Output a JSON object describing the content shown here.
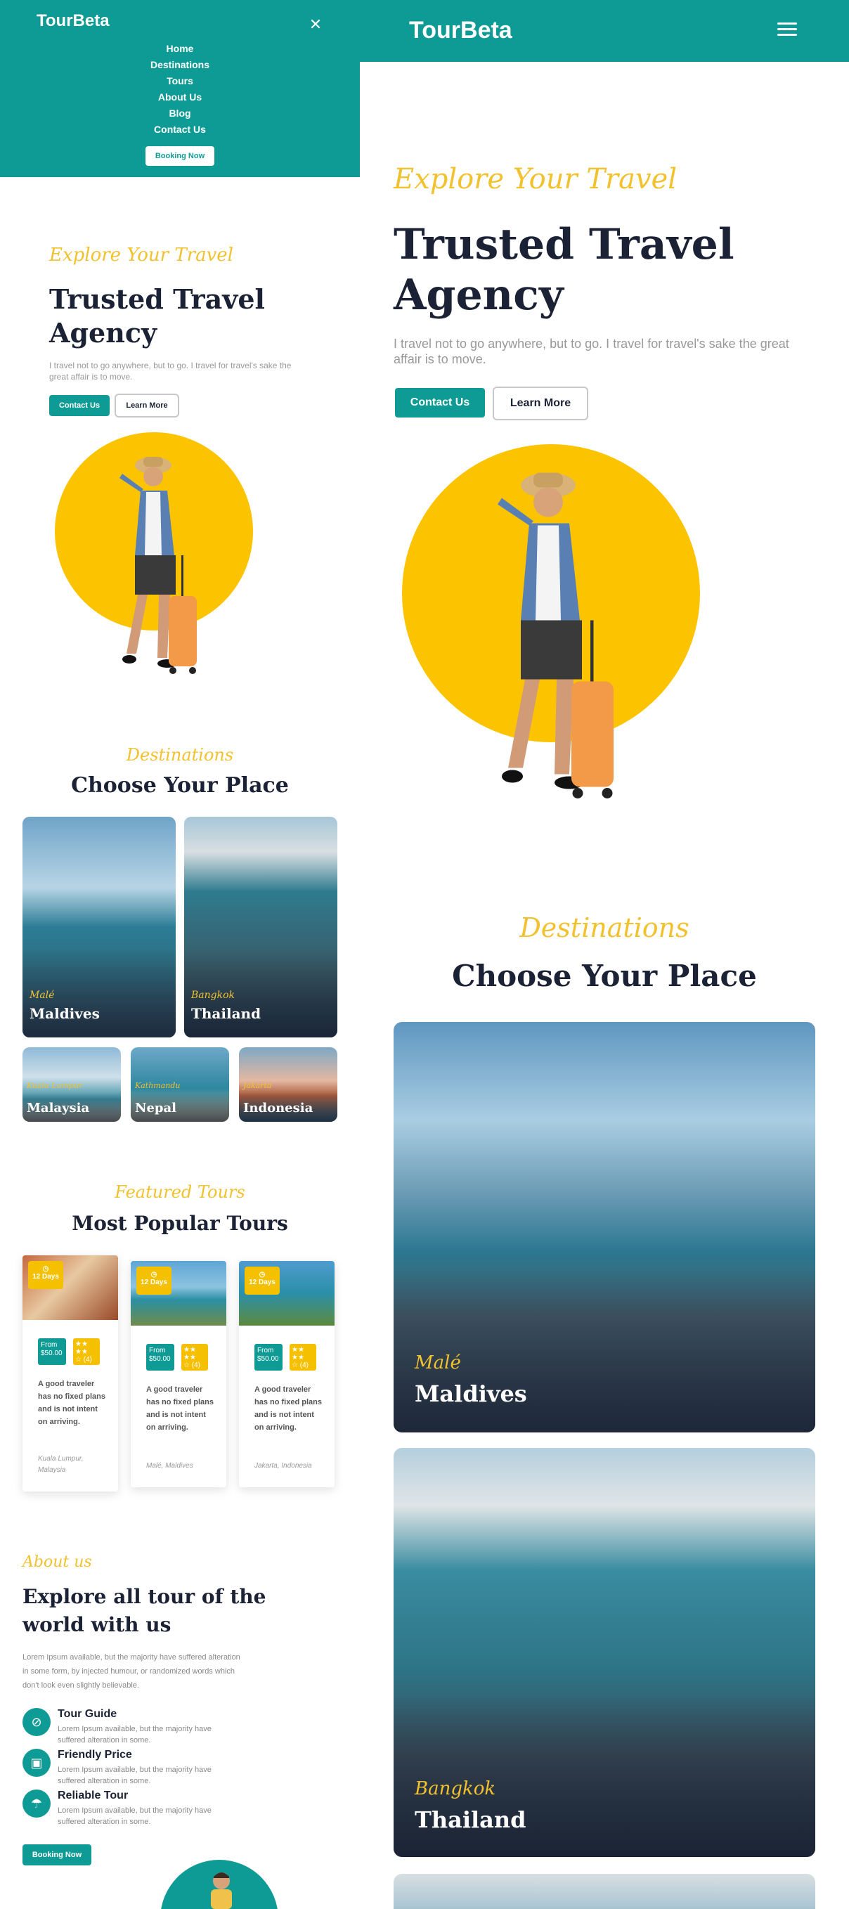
{
  "brand": "TourBeta",
  "menu": {
    "items": [
      "Home",
      "Destinations",
      "Tours",
      "About Us",
      "Blog",
      "Contact Us"
    ],
    "booking_label": "Booking Now"
  },
  "hero": {
    "script": "Explore Your Travel",
    "title_line1": "Trusted Travel",
    "title_line2": "Agency",
    "text": "I travel not to go anywhere, but to go. I travel for travel's sake the great affair is to move.",
    "contact_label": "Contact Us",
    "learn_label": "Learn More"
  },
  "destinations": {
    "script": "Destinations",
    "title": "Choose Your Place",
    "items": [
      {
        "city": "Malé",
        "country": "Maldives"
      },
      {
        "city": "Bangkok",
        "country": "Thailand"
      },
      {
        "city": "Kuala Lumpur",
        "country": "Malaysia"
      },
      {
        "city": "Kathmandu",
        "country": "Nepal"
      },
      {
        "city": "Jakarta",
        "country": "Indonesia"
      }
    ]
  },
  "tours": {
    "script": "Featured Tours",
    "title": "Most Popular Tours",
    "items": [
      {
        "days": "12 Days",
        "from": "From",
        "price": "$50.00",
        "rating_count": "(4)",
        "desc": "A good traveler has no fixed plans and is not intent on arriving.",
        "location": "Kuala Lumpur, Malaysia"
      },
      {
        "days": "12 Days",
        "from": "From",
        "price": "$50.00",
        "rating_count": "(4)",
        "desc": "A good traveler has no fixed plans and is not intent on arriving.",
        "location": "Malé, Maldives"
      },
      {
        "days": "12 Days",
        "from": "From",
        "price": "$50.00",
        "rating_count": "(4)",
        "desc": "A good traveler has no fixed plans and is not intent on arriving.",
        "location": "Jakarta, Indonesia"
      }
    ]
  },
  "about": {
    "script": "About us",
    "title_line1": "Explore all tour of the",
    "title_line2": "world with us",
    "text": "Lorem Ipsum available, but the majority have suffered alteration in some form, by injected humour, or randomized words which don't look even slightly believable.",
    "features": [
      {
        "title": "Tour Guide",
        "text": "Lorem Ipsum available, but the majority have suffered alteration in some.",
        "icon": "compass-icon"
      },
      {
        "title": "Friendly Price",
        "text": "Lorem Ipsum available, but the majority have suffered alteration in some.",
        "icon": "briefcase-icon"
      },
      {
        "title": "Reliable Tour",
        "text": "Lorem Ipsum available, but the majority have suffered alteration in some.",
        "icon": "umbrella-icon"
      }
    ],
    "booking_label": "Booking Now"
  },
  "colors": {
    "teal": "#0f9b95",
    "yellow": "#f5c000",
    "navy": "#1c2235"
  }
}
